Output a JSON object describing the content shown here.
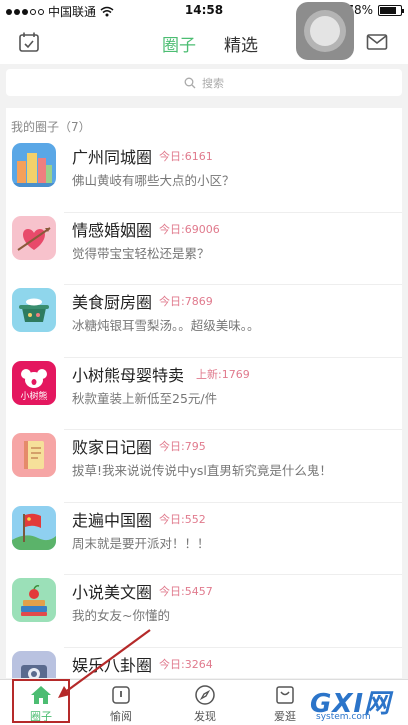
{
  "status_bar": {
    "carrier": "中国联通",
    "time": "14:58",
    "battery": "78%",
    "battery_level": 0.78
  },
  "nav": {
    "tabs": [
      {
        "label": "圈子",
        "active": true
      },
      {
        "label": "精选",
        "active": false
      }
    ],
    "left_icon": "calendar-check-icon",
    "right_icon": "mail-icon"
  },
  "search": {
    "placeholder": "搜索"
  },
  "section": {
    "title": "我的圈子（7）"
  },
  "circles": [
    {
      "name": "广州同城圈",
      "count": "今日:6161",
      "desc": "佛山黄岐有哪些大点的小区？",
      "icon": "city-buildings-icon"
    },
    {
      "name": "情感婚姻圈",
      "count": "今日:69006",
      "desc": "觉得带宝宝轻松还是累？",
      "icon": "heart-arrow-icon"
    },
    {
      "name": "美食厨房圈",
      "count": "今日:7869",
      "desc": "冰糖炖银耳雪梨汤。。超级美味。。",
      "icon": "cooking-pot-icon"
    },
    {
      "name": "小树熊母婴特卖",
      "count": "上新:1769",
      "desc": "秋款童装上新低至25元/件",
      "icon": "koala-icon",
      "badge_text": "小树熊"
    },
    {
      "name": "败家日记圈",
      "count": "今日:795",
      "desc": "拔草!我来说说传说中ysl直男斩究竟是什么鬼！",
      "icon": "notebook-icon"
    },
    {
      "name": "走遍中国圈",
      "count": "今日:552",
      "desc": "周末就是要开派对！！！",
      "icon": "china-flag-icon"
    },
    {
      "name": "小说美文圈",
      "count": "今日:5457",
      "desc": "我的女友~你懂的",
      "icon": "books-apple-icon"
    },
    {
      "name": "娱乐八卦圈",
      "count": "今日:3264",
      "desc": "",
      "icon": "camera-icon"
    }
  ],
  "tabbar": [
    {
      "label": "圈子",
      "icon": "home-icon",
      "active": true
    },
    {
      "label": "愉阅",
      "icon": "book-icon",
      "active": false
    },
    {
      "label": "发现",
      "icon": "compass-icon",
      "active": false
    },
    {
      "label": "爱逛",
      "icon": "bag-icon",
      "active": false
    }
  ],
  "watermark": {
    "main": "GXI网",
    "sub": "system.com"
  },
  "colors": {
    "accent": "#4cbd72",
    "count": "#e07a8d",
    "annotation": "#b52a2a"
  }
}
